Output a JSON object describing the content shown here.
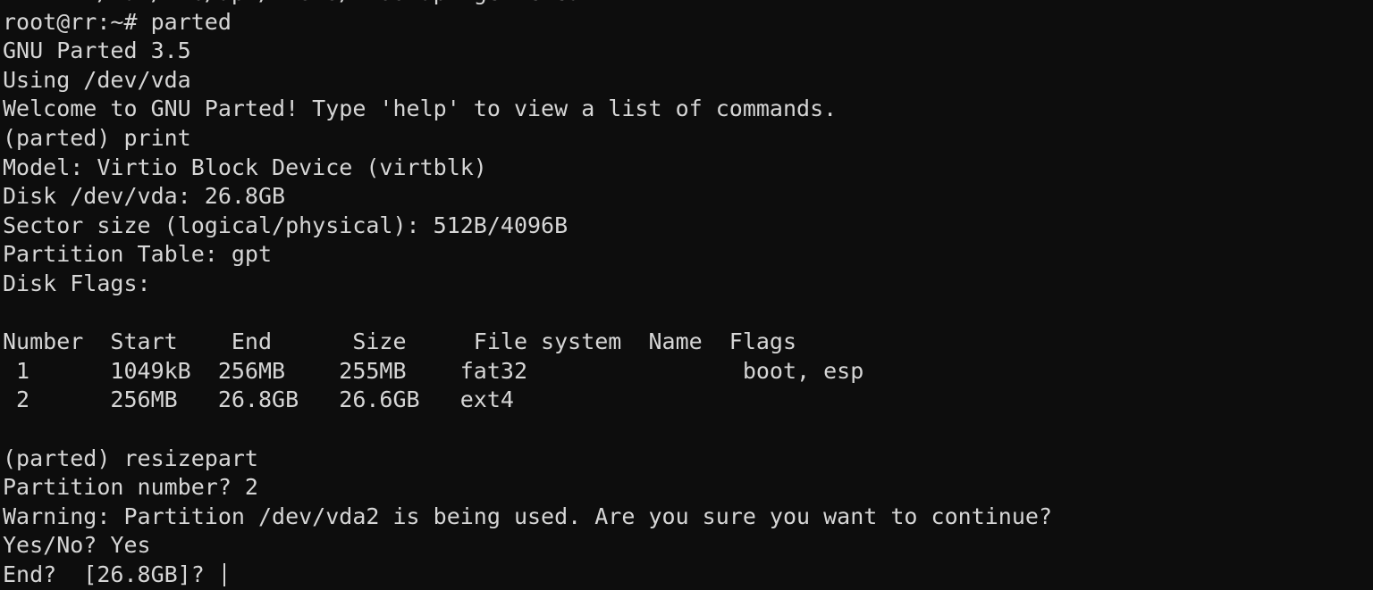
{
  "terminal": {
    "colors": {
      "background": "#0d0d0d",
      "foreground": "#d6d6d6",
      "cursor": "#d6d6d6"
    },
    "shell_prompt": "root@rr:~#",
    "program_prompt": "(parted)",
    "scrollback_partial_line": "rm -rf /var/lib/apt/lists/* && apt-get clean",
    "lines": [
      "rm -rf /var/lib/apt/lists/* && apt-get clean",
      "root@rr:~# parted",
      "GNU Parted 3.5",
      "Using /dev/vda",
      "Welcome to GNU Parted! Type 'help' to view a list of commands.",
      "(parted) print",
      "Model: Virtio Block Device (virtblk)",
      "Disk /dev/vda: 26.8GB",
      "Sector size (logical/physical): 512B/4096B",
      "Partition Table: gpt",
      "Disk Flags:",
      "",
      "Number  Start    End      Size     File system  Name  Flags",
      " 1      1049kB  256MB    255MB    fat32                boot, esp",
      " 2      256MB   26.8GB   26.6GB   ext4",
      "",
      "(parted) resizepart",
      "Partition number? 2",
      "Warning: Partition /dev/vda2 is being used. Are you sure you want to continue?",
      "Yes/No? Yes",
      "End?  [26.8GB]? "
    ],
    "commands": {
      "launch": "parted",
      "print": "print",
      "resizepart": "resizepart"
    },
    "version_banner": "GNU Parted 3.5",
    "device_in_use": "Using /dev/vda",
    "welcome": "Welcome to GNU Parted! Type 'help' to view a list of commands.",
    "disk_info": {
      "model_label": "Model:",
      "model_value": "Virtio Block Device (virtblk)",
      "disk_label": "Disk /dev/vda:",
      "disk_size": "26.8GB",
      "sector_size_label": "Sector size (logical/physical):",
      "sector_size_value": "512B/4096B",
      "partition_table_label": "Partition Table:",
      "partition_table_value": "gpt",
      "disk_flags_label": "Disk Flags:",
      "disk_flags_value": ""
    },
    "partition_table": {
      "headers": [
        "Number",
        "Start",
        "End",
        "Size",
        "File system",
        "Name",
        "Flags"
      ],
      "rows": [
        {
          "number": "1",
          "start": "1049kB",
          "end": "256MB",
          "size": "255MB",
          "filesystem": "fat32",
          "name": "",
          "flags": "boot, esp"
        },
        {
          "number": "2",
          "start": "256MB",
          "end": "26.8GB",
          "size": "26.6GB",
          "filesystem": "ext4",
          "name": "",
          "flags": ""
        }
      ]
    },
    "resize_dialog": {
      "command_line": "(parted) resizepart",
      "partition_number_prompt": "Partition number?",
      "partition_number_answer": "2",
      "warning": "Warning: Partition /dev/vda2 is being used. Are you sure you want to continue?",
      "confirm_prompt": "Yes/No?",
      "confirm_answer": "Yes",
      "end_prompt": "End?",
      "end_default": "[26.8GB]?",
      "end_value": ""
    }
  }
}
